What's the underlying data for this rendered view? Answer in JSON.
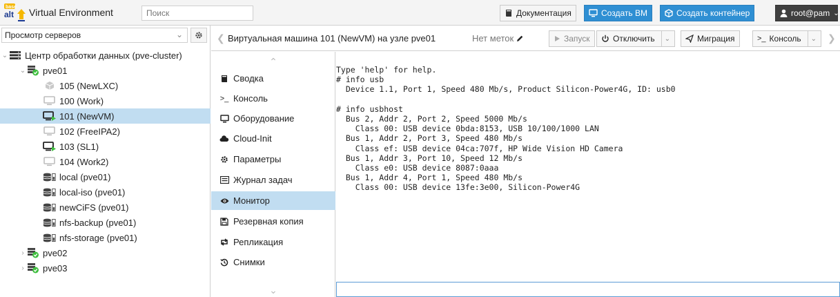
{
  "topbar": {
    "logo_text": "base alt",
    "app_title": "Virtual Environment",
    "search_placeholder": "Поиск",
    "docs_label": "Документация",
    "create_vm_label": "Создать ВМ",
    "create_ct_label": "Создать контейнер",
    "user_label": "root@pam"
  },
  "left": {
    "view_select": "Просмотр серверов",
    "tree": [
      {
        "label": "Центр обработки данных (pve-cluster)",
        "icon": "datacenter-icon",
        "level": 0,
        "expanded": true
      },
      {
        "label": "pve01",
        "icon": "node-online-icon",
        "level": 1,
        "expanded": true
      },
      {
        "label": "105 (NewLXC)",
        "icon": "container-stopped-icon",
        "level": 2
      },
      {
        "label": "100 (Work)",
        "icon": "vm-stopped-icon",
        "level": 2
      },
      {
        "label": "101 (NewVM)",
        "icon": "vm-running-icon",
        "level": 2,
        "selected": true
      },
      {
        "label": "102 (FreeIPA2)",
        "icon": "vm-stopped-icon",
        "level": 2
      },
      {
        "label": "103 (SL1)",
        "icon": "vm-running-icon",
        "level": 2
      },
      {
        "label": "104 (Work2)",
        "icon": "vm-stopped-icon",
        "level": 2
      },
      {
        "label": "local (pve01)",
        "icon": "storage-icon",
        "level": 2
      },
      {
        "label": "local-iso (pve01)",
        "icon": "storage-icon",
        "level": 2
      },
      {
        "label": "newCiFS (pve01)",
        "icon": "storage-icon",
        "level": 2
      },
      {
        "label": "nfs-backup (pve01)",
        "icon": "storage-icon",
        "level": 2
      },
      {
        "label": "nfs-storage (pve01)",
        "icon": "storage-icon",
        "level": 2
      },
      {
        "label": "pve02",
        "icon": "node-online-icon",
        "level": 1,
        "expanded": false
      },
      {
        "label": "pve03",
        "icon": "node-online-icon",
        "level": 1,
        "expanded": false
      }
    ]
  },
  "content": {
    "vm_title": "Виртуальная машина 101 (NewVM) на узле pve01",
    "tags_label": "Нет меток",
    "start_label": "Запуск",
    "shutdown_label": "Отключить",
    "migrate_label": "Миграция",
    "console_label": "Консоль"
  },
  "subnav": [
    {
      "label": "Сводка",
      "icon": "book-icon"
    },
    {
      "label": "Консоль",
      "icon": "terminal-icon"
    },
    {
      "label": "Оборудование",
      "icon": "monitor-icon"
    },
    {
      "label": "Cloud-Init",
      "icon": "cloud-icon"
    },
    {
      "label": "Параметры",
      "icon": "gear-icon"
    },
    {
      "label": "Журнал задач",
      "icon": "list-icon"
    },
    {
      "label": "Монитор",
      "icon": "eye-icon",
      "selected": true
    },
    {
      "label": "Резервная копия",
      "icon": "floppy-icon"
    },
    {
      "label": "Репликация",
      "icon": "retweet-icon"
    },
    {
      "label": "Снимки",
      "icon": "history-icon"
    }
  ],
  "console_lines": [
    "Type 'help' for help.",
    "# info usb",
    "  Device 1.1, Port 1, Speed 480 Mb/s, Product Silicon-Power4G, ID: usb0",
    "",
    "# info usbhost",
    "  Bus 2, Addr 2, Port 2, Speed 5000 Mb/s",
    "    Class 00: USB device 0bda:8153, USB 10/100/1000 LAN",
    "  Bus 1, Addr 2, Port 3, Speed 480 Mb/s",
    "    Class ef: USB device 04ca:707f, HP Wide Vision HD Camera",
    "  Bus 1, Addr 3, Port 10, Speed 12 Mb/s",
    "    Class e0: USB device 8087:0aaa",
    "  Bus 1, Addr 4, Port 1, Speed 480 Mb/s",
    "    Class 00: USB device 13fe:3e00, Silicon-Power4G"
  ],
  "colors": {
    "accent": "#2f8fd3",
    "selection": "#c1ddf1",
    "running": "#3fbf3f"
  }
}
